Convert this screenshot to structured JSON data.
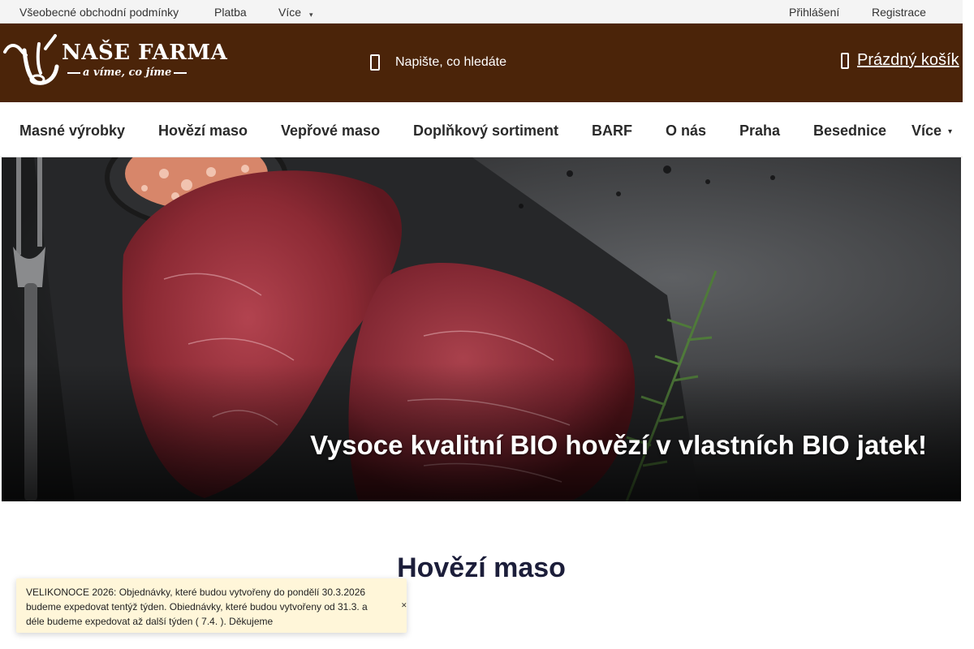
{
  "topbar": {
    "terms": "Všeobecné obchodní podmínky",
    "payment": "Platba",
    "more": "Více",
    "more_caret": "▾",
    "login": "Přihlášení",
    "register": "Registrace"
  },
  "header": {
    "logo_title": "NAŠE FARMA",
    "logo_subtitle": "a víme, co jíme",
    "search_placeholder": "Napište, co hledáte",
    "search_icon": "search-icon",
    "cart_label": "Prázdný košík",
    "cart_icon": "cart-icon",
    "bg_color": "#4b2409"
  },
  "nav": {
    "items": [
      "Masné výrobky",
      "Hovězí maso",
      "Vepřové maso",
      "Doplňkový sortiment",
      "BARF",
      "O nás",
      "Praha",
      "Besednice",
      "Více"
    ],
    "more_caret": "▾"
  },
  "hero": {
    "caption": "Vysoce kvalitní BIO hovězí v vlastních BIO jatek!"
  },
  "section": {
    "title": "Hovězí maso"
  },
  "notice": {
    "text": "VELIKONOCE 2026: Objednávky, které budou vytvořeny do pondělí 30.3.2026 budeme expedovat tentýž týden. Obiednávky, které budou vytvořeny od 31.3. a déle budeme expedovat až další týden ( 7.4. ). Děkujeme",
    "close": "✕",
    "bg_color": "#fff6d9"
  }
}
